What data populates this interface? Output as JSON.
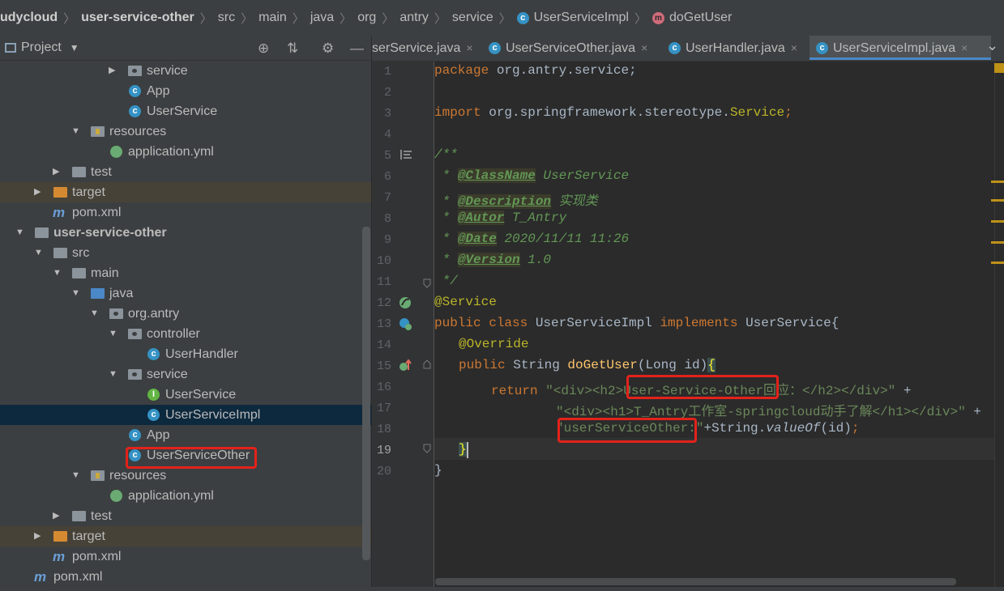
{
  "breadcrumb": {
    "items": [
      "udycloud",
      "user-service-other",
      "src",
      "main",
      "java",
      "org",
      "antry",
      "service",
      "UserServiceImpl",
      "doGetUser"
    ]
  },
  "project_panel": {
    "title": "Project",
    "dropdown": "▼",
    "locate": "⊕",
    "collapse": "⇅",
    "gear": "⚙",
    "minimize": "—"
  },
  "tree": [
    {
      "label": "service"
    },
    {
      "label": "App"
    },
    {
      "label": "UserService"
    },
    {
      "label": "resources"
    },
    {
      "label": "application.yml"
    },
    {
      "label": "test"
    },
    {
      "label": "target"
    },
    {
      "label": "pom.xml"
    },
    {
      "label": "user-service-other"
    },
    {
      "label": "src"
    },
    {
      "label": "main"
    },
    {
      "label": "java"
    },
    {
      "label": "org.antry"
    },
    {
      "label": "controller"
    },
    {
      "label": "UserHandler"
    },
    {
      "label": "service"
    },
    {
      "label": "UserService"
    },
    {
      "label": "UserServiceImpl"
    },
    {
      "label": "App"
    },
    {
      "label": "UserServiceOther"
    },
    {
      "label": "resources"
    },
    {
      "label": "application.yml"
    },
    {
      "label": "test"
    },
    {
      "label": "target"
    },
    {
      "label": "pom.xml"
    },
    {
      "label": "pom.xml"
    }
  ],
  "tabs": [
    {
      "label": "serService.java"
    },
    {
      "label": "UserServiceOther.java"
    },
    {
      "label": "UserHandler.java"
    },
    {
      "label": "UserServiceImpl.java"
    }
  ],
  "tab_close": "×",
  "tab_overflow": "⌄",
  "line_numbers": [
    "1",
    "2",
    "3",
    "4",
    "5",
    "6",
    "7",
    "8",
    "9",
    "10",
    "11",
    "12",
    "13",
    "14",
    "15",
    "16",
    "17",
    "18",
    "19",
    "20"
  ],
  "code": {
    "l1_kw": "package",
    "l1_rest": " org.antry.service;",
    "l3_kw": "import",
    "l3_rest": " org.springframework.stereotype.",
    "l3_cls": "Service",
    "l3_semi": ";",
    "l5": "/**",
    "l6_star": " * ",
    "l6_tag": "@ClassName",
    "l6_val": " UserService",
    "l7_star": " * ",
    "l7_tag": "@Description",
    "l7_val": " 实现类",
    "l8_star": " * ",
    "l8_tag": "@Autor",
    "l8_val": " T_Antry",
    "l9_star": " * ",
    "l9_tag": "@Date",
    "l9_val": " 2020/11/11 11:26",
    "l10_star": " * ",
    "l10_tag": "@Version",
    "l10_val": " 1.0",
    "l11": " */",
    "l12": "@Service",
    "l13_kw1": "public class",
    "l13_name": " UserServiceImpl ",
    "l13_kw2": "implements",
    "l13_rest": " UserService{",
    "l14": "@Override",
    "l15_kw": "public",
    "l15_type": " String ",
    "l15_fn": "doGetUser",
    "l15_rest": "(Long id)",
    "l15_brace": "{",
    "l16_kw": "return",
    "l16_str": " \"<div><h2>User-Service-Other回应：</h2></div>\"",
    "l16_plus": " +",
    "l17_str": "\"<div><h1>T_Antry工作室-springcloud动手了解</h1></div>\"",
    "l17_plus": " +",
    "l18_str": "\"userServiceOther:\"",
    "l18_plus": "+String.",
    "l18_fn": "valueOf",
    "l18_rest": "(id)",
    "l18_semi": ";",
    "l19": "}",
    "l20": "}"
  },
  "colors": {
    "highlight_box": "#e3221b",
    "keyword": "#cc7832",
    "string": "#6a8759",
    "annotation": "#bbb529",
    "doc_comment": "#629755"
  }
}
